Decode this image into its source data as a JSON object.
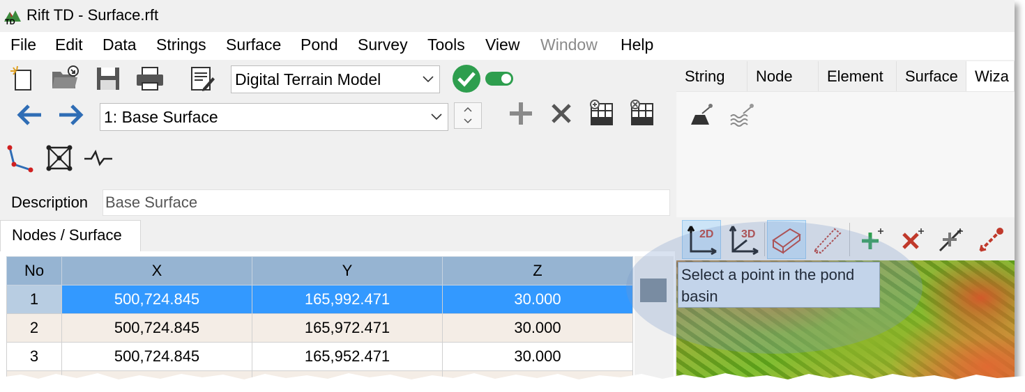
{
  "window": {
    "title": "Rift TD - Surface.rft",
    "logo_icon": "rift-td-logo-icon"
  },
  "menu": [
    {
      "label": "File",
      "enabled": true
    },
    {
      "label": "Edit",
      "enabled": true
    },
    {
      "label": "Data",
      "enabled": true
    },
    {
      "label": "Strings",
      "enabled": true
    },
    {
      "label": "Surface",
      "enabled": true
    },
    {
      "label": "Pond",
      "enabled": true
    },
    {
      "label": "Survey",
      "enabled": true
    },
    {
      "label": "Tools",
      "enabled": true
    },
    {
      "label": "View",
      "enabled": true
    },
    {
      "label": "Window",
      "enabled": false
    },
    {
      "label": "Help",
      "enabled": true
    }
  ],
  "toolbar": {
    "model_select": "Digital Terrain Model",
    "surface_select": "1: Base Surface",
    "icons": [
      "new-file-icon",
      "open-folder-icon",
      "save-icon",
      "print-icon",
      "edit-notes-icon",
      "green-check-icon",
      "toggle-switch-icon",
      "back-arrow-icon",
      "forward-arrow-icon",
      "spin-up-icon",
      "spin-down-icon",
      "add-icon",
      "delete-icon",
      "add-grid-icon",
      "remove-grid-icon",
      "polyline-icon",
      "triangle-mesh-icon",
      "profile-line-icon"
    ],
    "toggle_on": true
  },
  "description": {
    "label": "Description",
    "value": "Base Surface"
  },
  "left_tab": "Nodes / Surface",
  "grid": {
    "columns": [
      "No",
      "X",
      "Y",
      "Z"
    ],
    "rows": [
      {
        "no": "1",
        "x": "500,724.845",
        "y": "165,992.471",
        "z": "30.000",
        "selected": true
      },
      {
        "no": "2",
        "x": "500,724.845",
        "y": "165,972.471",
        "z": "30.000",
        "selected": false
      },
      {
        "no": "3",
        "x": "500,724.845",
        "y": "165,952.471",
        "z": "30.000",
        "selected": false
      }
    ]
  },
  "right_tabs": [
    {
      "label": "String"
    },
    {
      "label": "Node"
    },
    {
      "label": "Element"
    },
    {
      "label": "Surface"
    },
    {
      "label": "Wiza",
      "active": true
    }
  ],
  "wizard_icons": [
    "pond-volume-icon",
    "pond-water-level-icon"
  ],
  "view_toolbar": {
    "buttons": [
      {
        "icon": "view-2d-icon",
        "label": "2D",
        "active": true
      },
      {
        "icon": "view-3d-icon",
        "label": "3D",
        "active": false
      },
      {
        "icon": "solid-box-icon",
        "active": true
      },
      {
        "icon": "wire-box-icon",
        "active": false
      },
      {
        "icon": "add-point-icon",
        "active": false
      },
      {
        "icon": "delete-point-icon",
        "active": false
      },
      {
        "icon": "insert-point-icon",
        "active": false
      },
      {
        "icon": "pick-point-arrow-icon",
        "active": false
      }
    ]
  },
  "tooltip": "Select a point in the pond basin",
  "colors": {
    "selection": "#3399ff",
    "header": "#96b4d2",
    "alt_row": "#f4ede6",
    "tooltip_bg": "#e1ecf7",
    "accent_red": "#c0392b",
    "accent_green": "#2e9e4e",
    "accent_blue": "#2f6db5"
  }
}
